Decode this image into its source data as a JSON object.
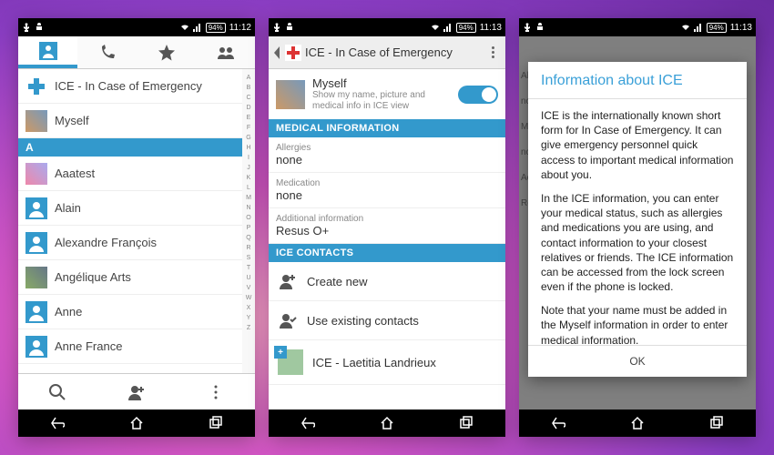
{
  "colors": {
    "accent": "#3399cc"
  },
  "screen1": {
    "status": {
      "battery": "94%",
      "time": "11:12"
    },
    "ice_label": "ICE - In Case of Emergency",
    "myself": "Myself",
    "section": "A",
    "contacts": [
      "Aaatest",
      "Alain",
      "Alexandre François",
      "Angélique Arts",
      "Anne",
      "Anne France"
    ],
    "index": [
      "A",
      "B",
      "C",
      "D",
      "E",
      "F",
      "G",
      "H",
      "I",
      "J",
      "K",
      "L",
      "M",
      "N",
      "O",
      "P",
      "Q",
      "R",
      "S",
      "T",
      "U",
      "V",
      "W",
      "X",
      "Y",
      "Z"
    ]
  },
  "screen2": {
    "status": {
      "battery": "94%",
      "time": "11:13"
    },
    "title": "ICE - In Case of Emergency",
    "myself": {
      "name": "Myself",
      "sub": "Show my name, picture and medical info in ICE view",
      "toggled": true
    },
    "sec_medical": "MEDICAL INFORMATION",
    "fields": [
      {
        "label": "Allergies",
        "value": "none"
      },
      {
        "label": "Medication",
        "value": "none"
      },
      {
        "label": "Additional information",
        "value": "Resus O+"
      }
    ],
    "sec_contacts": "ICE CONTACTS",
    "create_new": "Create new",
    "use_existing": "Use existing contacts",
    "ice_contact": "ICE - Laetitia Landrieux"
  },
  "screen3": {
    "status": {
      "battery": "94%",
      "time": "11:13"
    },
    "dialog_title": "Information about ICE",
    "para1": "ICE is the internationally known short form for In Case of Emergency. It can give emergency personnel quick access to important medical information about you.",
    "para2": "In the ICE information, you can enter your medical status, such as allergies and medications you are using, and contact information to your closest relatives or friends. The ICE information can be accessed from the lock screen even if the phone is locked.",
    "para3": "Note that your name must be added in the Myself information in order to enter medical information.",
    "ok": "OK",
    "peek": [
      "Al",
      "nc",
      "M",
      "nc",
      "Ac",
      "Re"
    ]
  }
}
